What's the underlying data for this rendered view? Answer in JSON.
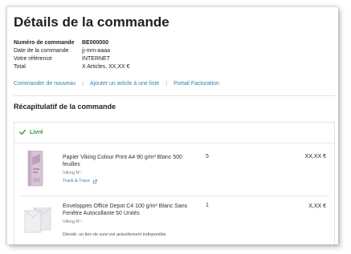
{
  "page": {
    "title": "Détails de la commande"
  },
  "order_details": [
    {
      "label": "Numéro de commande",
      "value": "BE000000"
    },
    {
      "label": "Date de la commande",
      "value": "jj-mm-aaaa"
    },
    {
      "label": "Votre référence",
      "value": "INTERNET"
    },
    {
      "label": "Total",
      "value": "X Articles, XX,XX €"
    }
  ],
  "actions": [
    {
      "label": "Commander de nouveau"
    },
    {
      "label": "Ajouter un article à une liste"
    },
    {
      "label": "Portail Facturation"
    }
  ],
  "summary": {
    "title": "Récapitulatif de la commande",
    "status": "Livré",
    "status_color": "#2c9a3d",
    "items": [
      {
        "name": "Papier Viking Colour Print A4 90 g/m² Blanc 500 feuilles",
        "sku": "Viking N°:",
        "tracking": "Track & Trace",
        "quantity": "5",
        "price": "XX,XX €",
        "image_icon": "paper-ream-icon"
      },
      {
        "name": "Enveloppes Office Depot C4 100 g/m² Blanc Sans Fenêtre Autocollante 50 Unités",
        "sku": "Viking N°:",
        "note": "Désolé, un lien de suivi est actuellement indisponible",
        "quantity": "1",
        "price": "X,XX €",
        "image_icon": "envelope-icon"
      }
    ]
  },
  "colors": {
    "link": "#2f7fb2",
    "text": "#222222"
  }
}
